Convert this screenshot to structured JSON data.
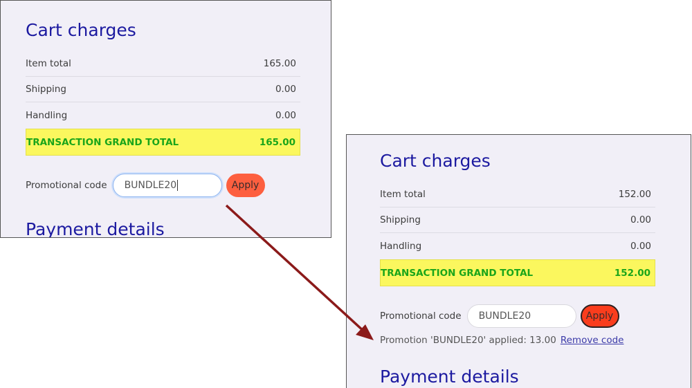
{
  "before": {
    "title": "Cart charges",
    "rows": [
      {
        "label": "Item total",
        "value": "165.00"
      },
      {
        "label": "Shipping",
        "value": "0.00"
      },
      {
        "label": "Handling",
        "value": "0.00"
      }
    ],
    "grand_total": {
      "label": "TRANSACTION GRAND TOTAL",
      "value": "165.00"
    },
    "promo": {
      "label": "Promotional code",
      "value": "BUNDLE20",
      "apply_label": "Apply"
    },
    "next_section_title": "Payment details"
  },
  "after": {
    "title": "Cart charges",
    "rows": [
      {
        "label": "Item total",
        "value": "152.00"
      },
      {
        "label": "Shipping",
        "value": "0.00"
      },
      {
        "label": "Handling",
        "value": "0.00"
      }
    ],
    "grand_total": {
      "label": "TRANSACTION GRAND TOTAL",
      "value": "152.00"
    },
    "promo": {
      "label": "Promotional code",
      "value": "BUNDLE20",
      "apply_label": "Apply",
      "message": "Promotion 'BUNDLE20' applied: 13.00",
      "remove_label": "Remove code"
    },
    "next_section_title": "Payment details"
  },
  "colors": {
    "panel_bg": "#f1eff7",
    "title": "#1c1aa0",
    "grand_bg": "#fbf75e",
    "grand_text": "#1aa51a",
    "apply_bg": "#fd5f3f",
    "arrow": "#8b1a1a"
  }
}
